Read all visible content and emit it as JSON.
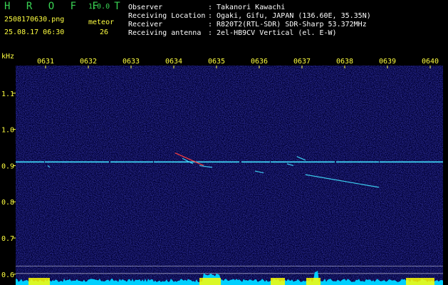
{
  "app": {
    "name": "H R O F F T",
    "version": "1.0.0"
  },
  "file": {
    "name": "2508170630.png",
    "datetime": "25.08.17 06:30"
  },
  "meteor": {
    "label": "meteor",
    "count": "26"
  },
  "station": {
    "rows": [
      {
        "key": "Observer",
        "sep": ":",
        "value": "Takanori Kawachi"
      },
      {
        "key": "Receiving Location",
        "sep": ":",
        "value": "Ogaki, Gifu, JAPAN (136.60E, 35.35N)"
      },
      {
        "key": "Receiver",
        "sep": ":",
        "value": "R820T2(RTL-SDR) SDR-Sharp 53.372MHz"
      },
      {
        "key": "Receiving antenna",
        "sep": ":",
        "value": "2el-HB9CV Vertical (el. E-W)"
      }
    ]
  },
  "colors": {
    "background": "#000000",
    "plot_background": "#0a0a3c",
    "text_primary": "#ffff40",
    "text_logo": "#39d353",
    "text_info": "#ffffff",
    "carrier": "#40e0ff",
    "echo": "#ff4040",
    "spectrum_fill": "#00d0ff",
    "spectrum_peak": "#ffff00"
  },
  "chart_data": {
    "type": "heatmap",
    "ylabel": "kHz",
    "x_tick_labels": [
      "0631",
      "0632",
      "0633",
      "0634",
      "0635",
      "0636",
      "0637",
      "0638",
      "0639",
      "0640"
    ],
    "y_tick_labels": [
      "1.1",
      "1.0",
      "0.9",
      "0.8",
      "0.7",
      "0.6"
    ],
    "y_ticks": [
      1.1,
      1.0,
      0.9,
      0.8,
      0.7,
      0.6
    ],
    "ylim": [
      0.58,
      1.2
    ],
    "xlim": [
      0,
      10
    ],
    "carrier_frequency_khz": 0.91,
    "echoes": [
      {
        "t_start": 3.73,
        "t_end": 4.4,
        "f_start": 0.935,
        "f_end": 0.9
      },
      {
        "t_start": 3.9,
        "t_end": 4.15,
        "f_start": 0.92,
        "f_end": 0.905
      },
      {
        "t_start": 4.3,
        "t_end": 4.6,
        "f_start": 0.9,
        "f_end": 0.895
      },
      {
        "t_start": 5.6,
        "t_end": 5.8,
        "f_start": 0.885,
        "f_end": 0.88
      },
      {
        "t_start": 6.35,
        "t_end": 6.5,
        "f_start": 0.905,
        "f_end": 0.9
      },
      {
        "t_start": 6.58,
        "t_end": 6.78,
        "f_start": 0.925,
        "f_end": 0.915
      },
      {
        "t_start": 6.78,
        "t_end": 8.5,
        "f_start": 0.875,
        "f_end": 0.84
      },
      {
        "t_start": 0.75,
        "t_end": 0.8,
        "f_start": 0.9,
        "f_end": 0.895
      }
    ]
  }
}
